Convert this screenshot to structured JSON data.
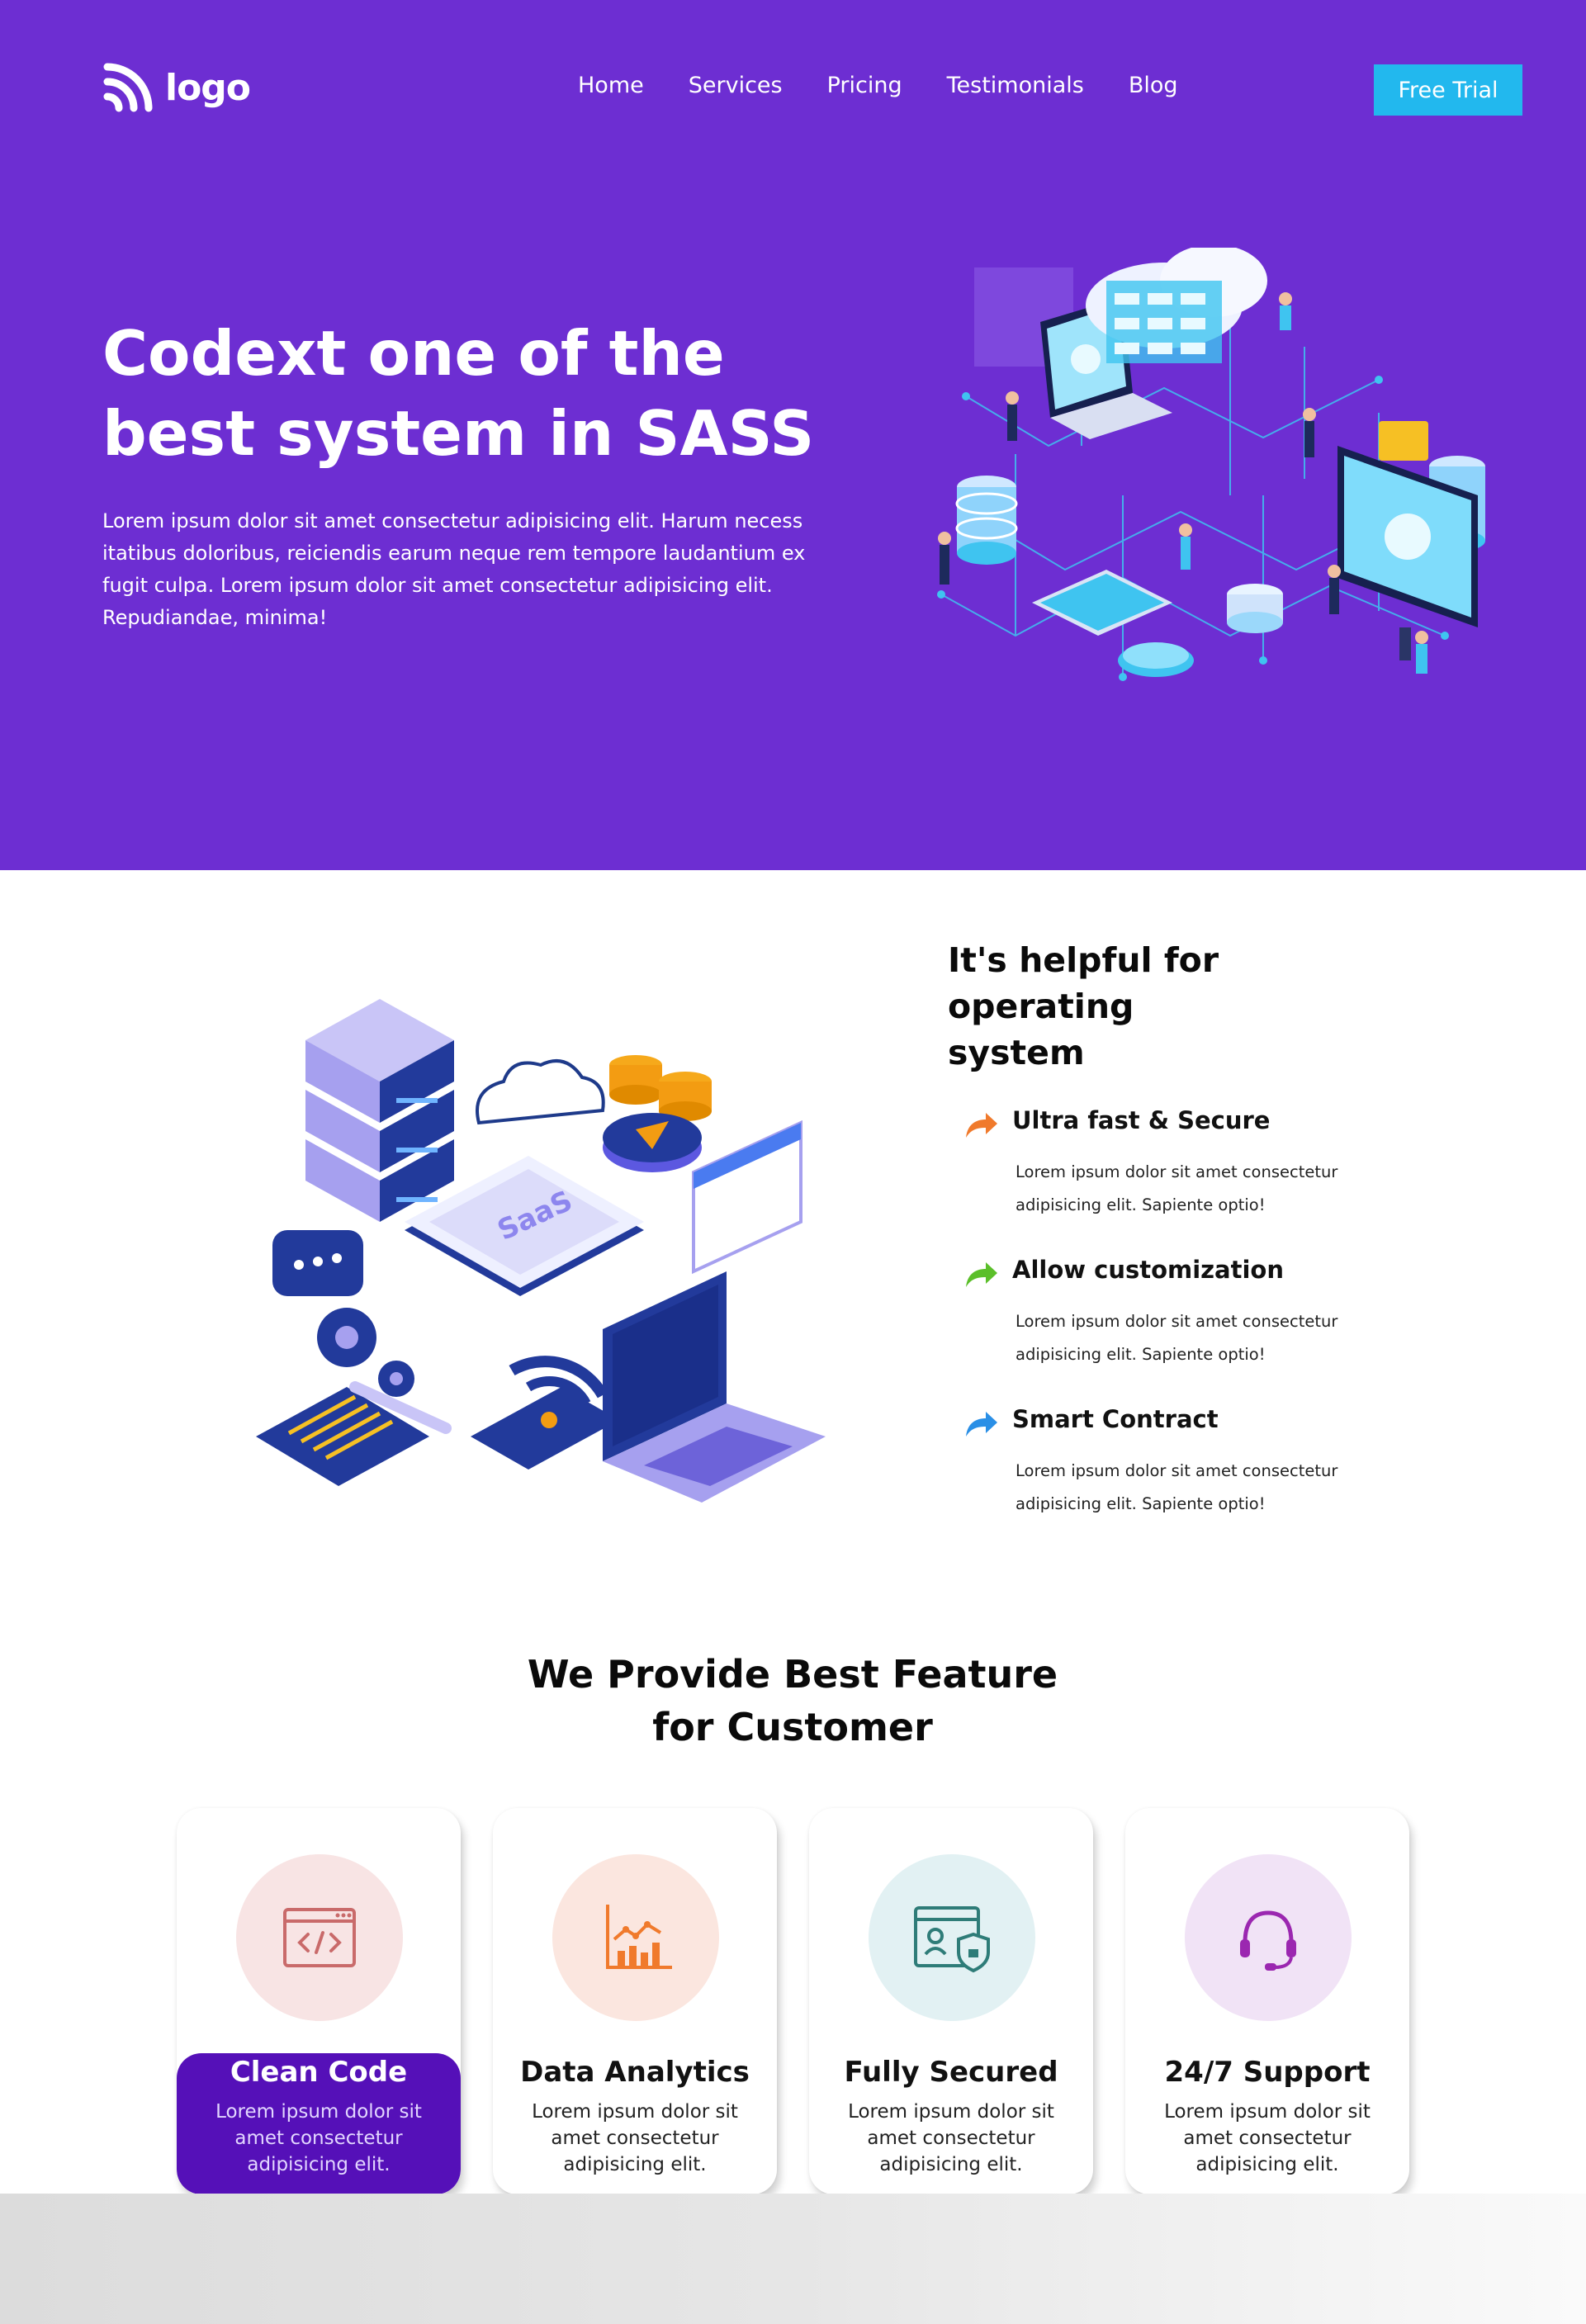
{
  "header": {
    "logo_text": "logo",
    "logo_icon": "wifi-arcs-icon",
    "nav": [
      "Home",
      "Services",
      "Pricing",
      "Testimonials",
      "Blog"
    ],
    "cta_label": "Free Trial"
  },
  "hero": {
    "title_lines": [
      "Codext one of the",
      "best system in SASS"
    ],
    "text_lines": [
      "Lorem ipsum dolor sit amet consectetur adipisicing elit. Harum necess",
      "itatibus doloribus, reiciendis earum neque rem tempore laudantium ex",
      "fugit culpa. Lorem ipsum dolor sit amet consectetur adipisicing elit.",
      "Repudiandae, minima!"
    ]
  },
  "operating": {
    "title_lines": [
      "It's helpful for operating",
      "system"
    ],
    "illustration_label": "SaaS",
    "features": [
      {
        "title": "Ultra fast & Secure",
        "icon": "share-arrow-icon",
        "color": "#f07a2c",
        "desc_lines": [
          "Lorem ipsum dolor sit amet consectetur",
          "adipisicing elit. Sapiente optio!"
        ]
      },
      {
        "title": "Allow customization",
        "icon": "share-arrow-icon",
        "color": "#5bbf2a",
        "desc_lines": [
          "Lorem ipsum dolor sit amet consectetur",
          "adipisicing elit. Sapiente optio!"
        ]
      },
      {
        "title": "Smart Contract",
        "icon": "share-arrow-icon",
        "color": "#2a8fe6",
        "desc_lines": [
          "Lorem ipsum dolor sit amet consectetur",
          "adipisicing elit. Sapiente optio!"
        ]
      }
    ]
  },
  "features_section": {
    "title_lines": [
      "We Provide Best Feature",
      "for Customer"
    ],
    "cards": [
      {
        "title": "Clean Code",
        "icon": "code-window-icon",
        "bg": "#f8e4e4",
        "text_lines": [
          "Lorem ipsum dolor sit",
          "amet consectetur",
          "adipisicing elit."
        ]
      },
      {
        "title": "Data Analytics",
        "icon": "bar-chart-icon",
        "bg": "#fbe6df",
        "text_lines": [
          "Lorem ipsum dolor sit",
          "amet consectetur",
          "adipisicing elit."
        ]
      },
      {
        "title": "Fully Secured",
        "icon": "secure-profile-icon",
        "bg": "#e2f1f3",
        "text_lines": [
          "Lorem ipsum dolor sit",
          "amet consectetur",
          "adipisicing elit."
        ]
      },
      {
        "title": "24/7 Support",
        "icon": "headset-icon",
        "bg": "#f1e3f6",
        "text_lines": [
          "Lorem ipsum dolor sit",
          "amet consectetur",
          "adipisicing elit."
        ]
      }
    ]
  },
  "colors": {
    "hero_bg": "#6d2ed2",
    "cta_bg": "#22b8ee",
    "active_card_bg": "#5510b8"
  }
}
